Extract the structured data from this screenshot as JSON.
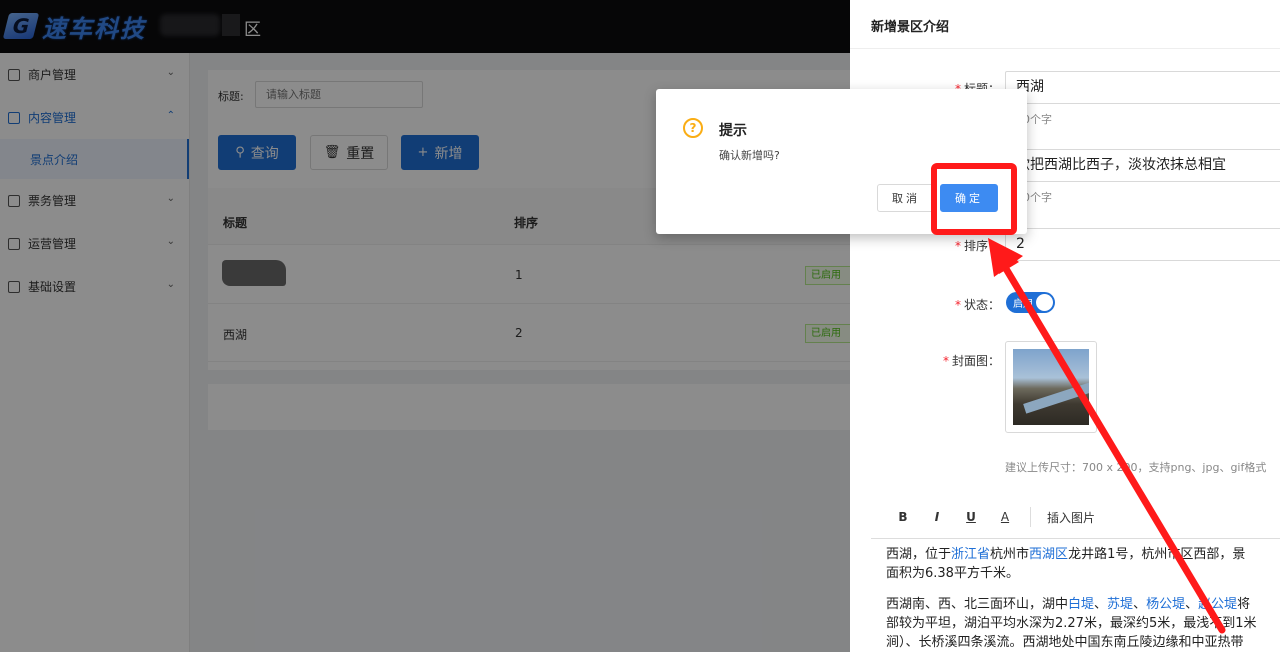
{
  "header": {
    "logo_mark": "G",
    "logo_text": "速车科技",
    "title": "区"
  },
  "sidebar": {
    "items": [
      {
        "label": "商户管理",
        "icon": "list-icon",
        "expanded": false
      },
      {
        "label": "内容管理",
        "icon": "document-icon",
        "expanded": true,
        "children": [
          {
            "label": "景点介绍",
            "active": true
          }
        ]
      },
      {
        "label": "票务管理",
        "icon": "ticket-icon",
        "expanded": false
      },
      {
        "label": "运营管理",
        "icon": "operations-icon",
        "expanded": false
      },
      {
        "label": "基础设置",
        "icon": "settings-icon",
        "expanded": false
      }
    ],
    "chevron_down": "⌄",
    "chevron_up": "⌃"
  },
  "filters": {
    "title_label": "标题:",
    "title_placeholder": "请输入标题"
  },
  "actions": {
    "search": "查询",
    "reset": "重置",
    "add": "新增",
    "search_icon": "⚲",
    "reset_icon": "🗑",
    "add_icon": "+"
  },
  "table": {
    "columns": [
      "标题",
      "排序"
    ],
    "rows": [
      {
        "title": "",
        "has_thumbnail": true,
        "sort": "1",
        "status": "已启用"
      },
      {
        "title": "西湖",
        "has_thumbnail": false,
        "sort": "2",
        "status": "已启用"
      }
    ]
  },
  "drawer": {
    "title": "新增景区介绍",
    "fields": {
      "title_label": "标题：",
      "title_value": "西湖",
      "title_hint": "长20个字",
      "subtitle_value": "欲把西湖比西子，淡妆浓抹总相宜",
      "subtitle_hint": "长50个字",
      "sort_label": "排序：",
      "sort_value": "2",
      "status_label": "状态：",
      "status_switch_text": "启用",
      "status_on": true,
      "cover_label": "封面图：",
      "upload_hint": "建议上传尺寸：700 x 200，支持png、jpg、gif格式"
    },
    "editor": {
      "toolbar": [
        "B",
        "I",
        "U",
        "A"
      ],
      "insert_image": "插入图片",
      "para1_line1": [
        "西湖，位于",
        "浙江省",
        "杭州市",
        "西湖区",
        "龙井路1号，杭州市区西部，景"
      ],
      "para1_line2": "面积为6.38平方千米。",
      "para2_line1": [
        "西湖南、西、北三面环山，湖中",
        "白堤",
        "、",
        "苏堤",
        "、",
        "杨公堤",
        "、",
        "赵公堤",
        "将"
      ],
      "para2_line2": "部较为平坦，湖泊平均水深为2.27米，最深约5米，最浅不到1米",
      "para2_line3": "涧）、长桥溪四条溪流。西湖地处中国东南丘陵边缘和中亚热带"
    }
  },
  "modal": {
    "icon": "?",
    "title": "提示",
    "message": "确认新增吗?",
    "cancel": "取消",
    "confirm": "确定"
  },
  "colors": {
    "primary": "#1f6fd6",
    "confirm_button": "#3d8bf2",
    "warning": "#faad14",
    "annotation": "#ff1a1a",
    "success": "#52c41a"
  }
}
